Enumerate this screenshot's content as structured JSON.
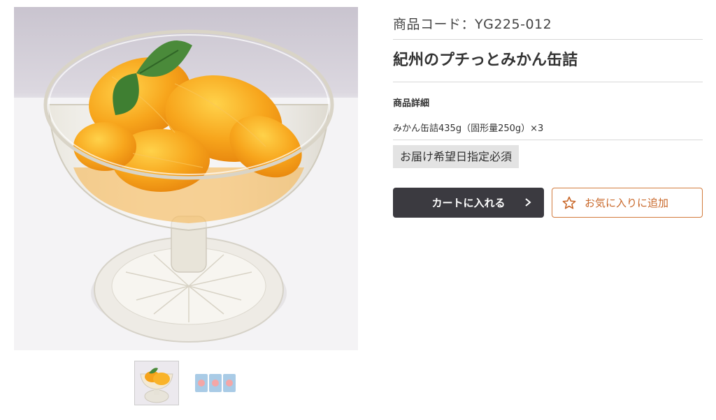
{
  "gallery": {
    "main_image_alt": "mandarin-orange-dessert-in-glass-cup",
    "thumbnails": [
      "mandarin-dessert-thumbnail",
      "canned-product-thumbnail"
    ]
  },
  "product": {
    "code_label": "商品コード：YG225-012",
    "name": "紀州のプチっとみかん缶詰",
    "detail_heading": "商品詳細",
    "detail_text": "みかん缶詰435g（固形量250g）×3",
    "notice_badge": "お届け希望日指定必須"
  },
  "actions": {
    "cart_label": "カートに入れる",
    "favorite_label": "お気に入りに追加"
  },
  "colors": {
    "cart_button_bg": "#3b3a40",
    "favorite_accent": "#c9682a",
    "badge_bg": "#e3e3e3"
  }
}
